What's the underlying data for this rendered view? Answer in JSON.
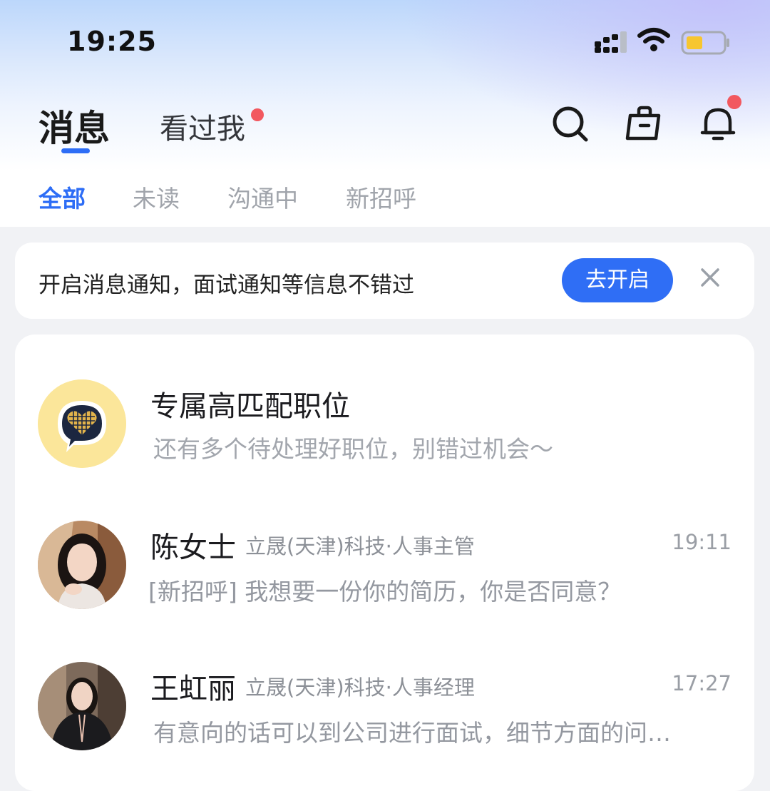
{
  "status_bar": {
    "time": "19:25"
  },
  "header": {
    "tabs": [
      {
        "label": "消息",
        "active": true
      },
      {
        "label": "看过我",
        "has_dot": true
      }
    ],
    "icons": [
      "search-icon",
      "briefcase-icon",
      "bell-icon"
    ],
    "bell_has_dot": true
  },
  "filters": [
    "全部",
    "未读",
    "沟通中",
    "新招呼"
  ],
  "notice": {
    "text": "开启消息通知，面试通知等信息不错过",
    "button": "去开启"
  },
  "conversations": [
    {
      "title": "专属高匹配职位",
      "preview": "还有多个待处理好职位，别错过机会～",
      "icon": "heart-chat-icon"
    },
    {
      "name": "陈女士",
      "company": "立晟(天津)科技·人事主管",
      "time": "19:11",
      "preview": "[新招呼] 我想要一份你的简历，你是否同意？"
    },
    {
      "name": "王虹丽",
      "company": "立晟(天津)科技·人事经理",
      "time": "17:27",
      "preview": "有意向的话可以到公司进行面试，细节方面的问…"
    }
  ],
  "colors": {
    "accent": "#2d6df6",
    "badge": "#f2585f"
  }
}
